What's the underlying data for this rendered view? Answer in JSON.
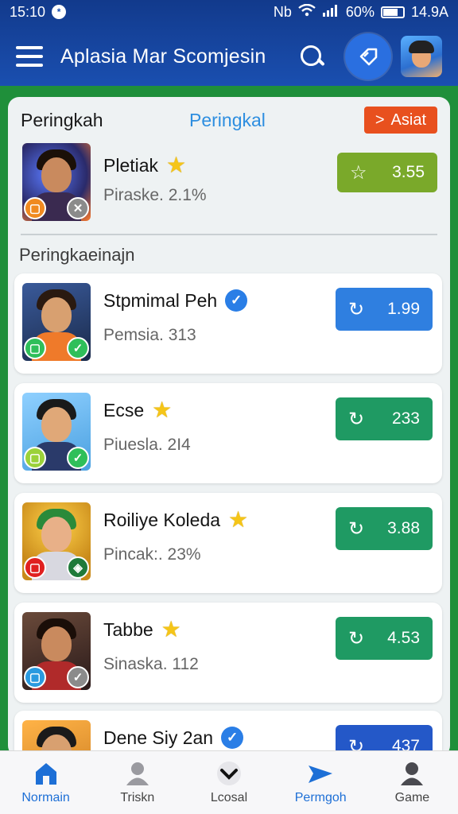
{
  "status": {
    "time": "15:10",
    "icons_left": "*",
    "net": "Nb",
    "signal_text": "4G",
    "battery": "60%",
    "clock_right": "14.9A"
  },
  "app": {
    "title": "Aplasia Mar Scomjesin"
  },
  "panel": {
    "tab_left": "Peringkah",
    "tab_center": "Peringkal",
    "action_button": "Asiat",
    "featured": {
      "name": "Pletiak",
      "sub": "Piraske. 2.1%",
      "score": "3.55",
      "color": "#7aa92a"
    },
    "section_label": "Peringkaeinajn",
    "rows": [
      {
        "name": "Stpmimal Peh",
        "sub": "Pemsia. 313",
        "score": "1.99",
        "color": "#2f7fe0",
        "mark": "verified"
      },
      {
        "name": "Ecse",
        "sub": "Piuesla. 2I4",
        "score": "233",
        "color": "#1f9a63",
        "mark": "star"
      },
      {
        "name": "Roiliye Koleda",
        "sub": "Pincak:. 23%",
        "score": "3.88",
        "color": "#1f9a63",
        "mark": "star"
      },
      {
        "name": "Tabbe",
        "sub": "Sinaska. 112",
        "score": "4.53",
        "color": "#1f9a63",
        "mark": "star"
      },
      {
        "name": "Dene Siy 2an",
        "sub": "",
        "score": "437",
        "color": "#2458c8",
        "mark": "verified"
      }
    ]
  },
  "nav": [
    {
      "label": "Normain",
      "icon": "home-icon"
    },
    {
      "label": "Triskn",
      "icon": "person-icon"
    },
    {
      "label": "Lcosal",
      "icon": "chevron-down-icon"
    },
    {
      "label": "Permgoh",
      "icon": "send-icon"
    },
    {
      "label": "Game",
      "icon": "profile-icon"
    }
  ]
}
